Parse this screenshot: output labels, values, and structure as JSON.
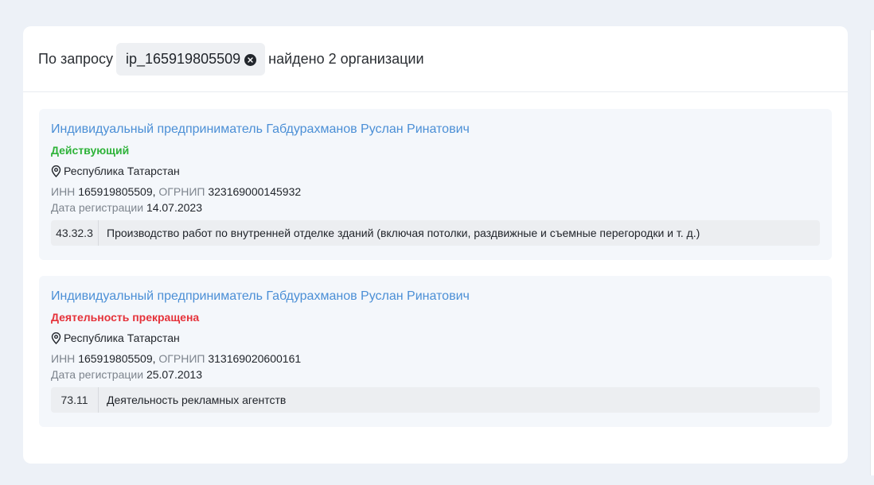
{
  "search": {
    "prefix": "По запросу",
    "query": "ip_165919805509",
    "suffix": "найдено 2 организации"
  },
  "colors": {
    "active": "#2fb33a",
    "inactive": "#e5323a",
    "link": "#4b8fd6"
  },
  "results": [
    {
      "name": "Индивидуальный предприниматель Габдурахманов Руслан Ринатович",
      "status": "Действующий",
      "status_type": "active",
      "region": "Республика Татарстан",
      "inn_label": "ИНН",
      "inn": "165919805509,",
      "ogrnip_label": "ОГРНИП",
      "ogrnip": "323169000145932",
      "date_label": "Дата регистрации",
      "date": "14.07.2023",
      "okved_code": "43.32.3",
      "okved_name": "Производство работ по внутренней отделке зданий (включая потолки, раздвижные и съемные перегородки и т. д.)"
    },
    {
      "name": "Индивидуальный предприниматель Габдурахманов Руслан Ринатович",
      "status": "Деятельность прекращена",
      "status_type": "inactive",
      "region": "Республика Татарстан",
      "inn_label": "ИНН",
      "inn": "165919805509,",
      "ogrnip_label": "ОГРНИП",
      "ogrnip": "313169020600161",
      "date_label": "Дата регистрации",
      "date": "25.07.2013",
      "okved_code": "73.11",
      "okved_name": "Деятельность рекламных агентств"
    }
  ]
}
